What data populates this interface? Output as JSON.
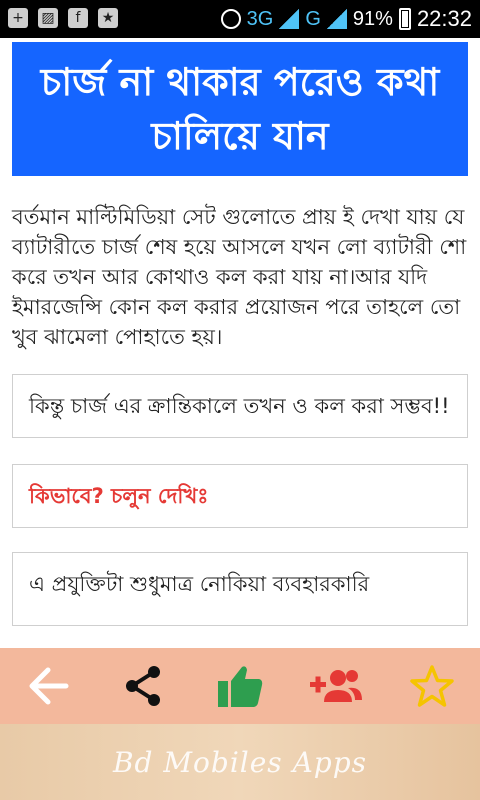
{
  "status_bar": {
    "network": "3G",
    "network2": "G",
    "battery_percent": "91%",
    "time": "22:32"
  },
  "article": {
    "title": "চার্জ না থাকার পরেও কথা চালিয়ে যান",
    "paragraph": "বর্তমান মাল্টিমিডিয়া সেট গুলোতে প্রায় ই দেখা যায় যে ব্যাটারীতে চার্জ শেষ হয়ে আসলে যখন লো ব্যাটারী শো করে তখন আর কোথাও কল করা যায় না।আর যদি ইমারজেন্সি কোন কল করার প্রয়োজন পরে তাহলে তো খুব ঝামেলা পোহাতে হয়।",
    "card_text": "কিন্তু চার্জ এর ক্রান্তিকালে তখন ও কল করা সম্ভব!!",
    "card_heading": "কিভাবে? চলুন দেখিঃ",
    "card_partial": "এ প্রযুক্তিটা শুধুমাত্র নোকিয়া ব্যবহারকারি"
  },
  "toolbar": {
    "back": "back-arrow-icon",
    "share": "share-icon",
    "like": "thumbs-up-icon",
    "add_friend": "add-user-icon",
    "favorite": "star-icon"
  },
  "ad": {
    "text": "Bd Mobiles Apps"
  },
  "colors": {
    "title_bg": "#1565ff",
    "toolbar_bg": "#f3b89c",
    "heading_red": "#e53935",
    "like_green": "#2e9e4f",
    "add_red": "#e53935",
    "star_yellow": "#f5c400"
  }
}
